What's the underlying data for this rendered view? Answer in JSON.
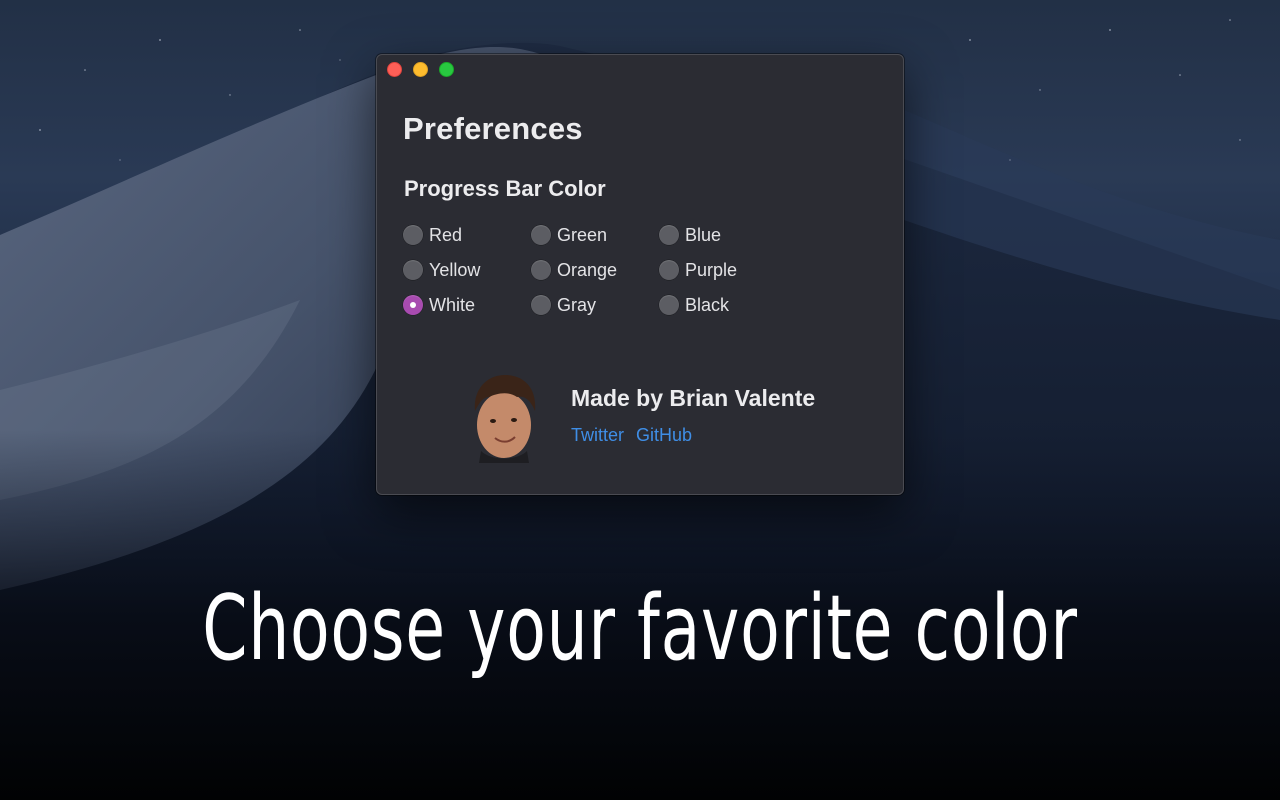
{
  "window": {
    "title": "Preferences",
    "section_title": "Progress Bar Color",
    "color_options": [
      {
        "label": "Red",
        "checked": false
      },
      {
        "label": "Green",
        "checked": false
      },
      {
        "label": "Blue",
        "checked": false
      },
      {
        "label": "Yellow",
        "checked": false
      },
      {
        "label": "Orange",
        "checked": false
      },
      {
        "label": "Purple",
        "checked": false
      },
      {
        "label": "White",
        "checked": true
      },
      {
        "label": "Gray",
        "checked": false
      },
      {
        "label": "Black",
        "checked": false
      }
    ],
    "selected_color": "White",
    "accent_color": "#a84bb0",
    "author": {
      "name": "Made by Brian Valente",
      "links": [
        "Twitter",
        "GitHub"
      ],
      "link_color": "#3f8ee6"
    }
  },
  "caption": "Choose your favorite color"
}
